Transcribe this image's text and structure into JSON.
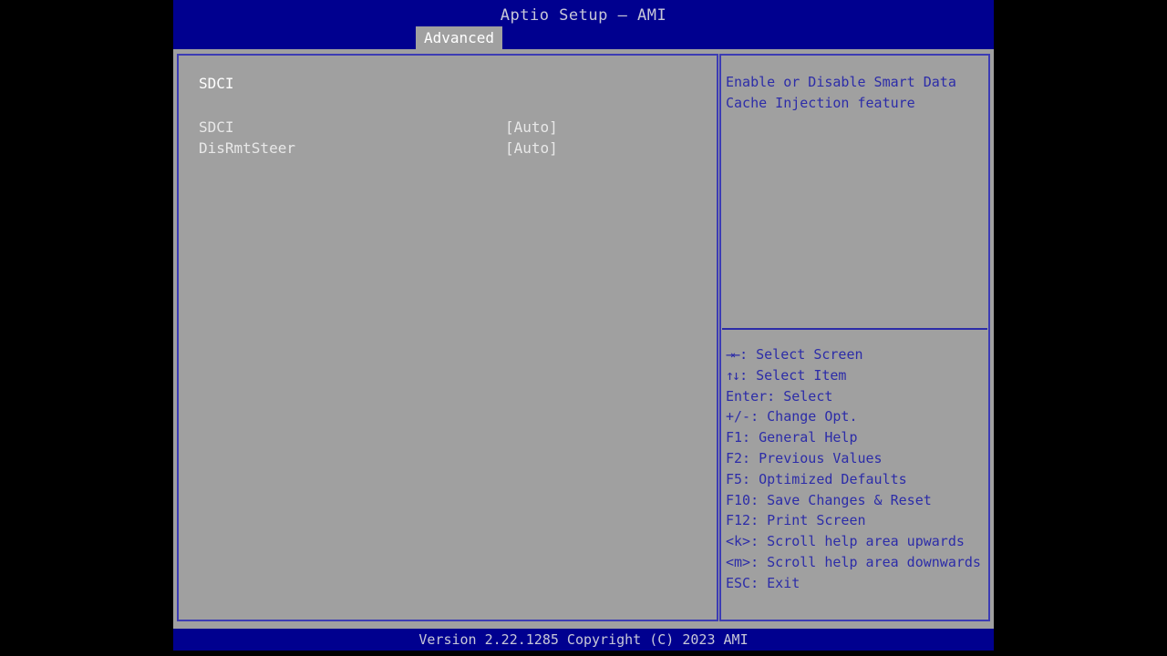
{
  "window": {
    "title": "Aptio Setup – AMI"
  },
  "tabs": [
    {
      "label": "Advanced",
      "active": true
    }
  ],
  "left_panel": {
    "section_title": "SDCI",
    "options": [
      {
        "label": "SDCI",
        "value": "[Auto]"
      },
      {
        "label": "DisRmtSteer",
        "value": "[Auto]"
      }
    ]
  },
  "right_panel": {
    "help_text": "Enable or Disable Smart Data Cache Injection feature",
    "key_legend": [
      {
        "glyph": "→←",
        "text": ": Select Screen"
      },
      {
        "glyph": "↑↓",
        "text": ": Select Item"
      },
      {
        "glyph": "",
        "text": "Enter: Select"
      },
      {
        "glyph": "",
        "text": "+/-: Change Opt."
      },
      {
        "glyph": "",
        "text": "F1: General Help"
      },
      {
        "glyph": "",
        "text": "F2: Previous Values"
      },
      {
        "glyph": "",
        "text": "F5: Optimized Defaults"
      },
      {
        "glyph": "",
        "text": "F10: Save Changes & Reset"
      },
      {
        "glyph": "",
        "text": "F12: Print Screen"
      },
      {
        "glyph": "",
        "text": "<k>: Scroll help area upwards"
      },
      {
        "glyph": "",
        "text": "<m>: Scroll help area downwards"
      },
      {
        "glyph": "",
        "text": "ESC: Exit"
      }
    ]
  },
  "footer": {
    "version_text": "Version 2.22.1285 Copyright (C) 2023 AMI"
  },
  "colors": {
    "header_blue": "#00008f",
    "panel_gray": "#a0a0a0",
    "border_blue": "#3c3cb4",
    "help_blue": "#2c2ca8",
    "text_white": "#ffffff",
    "footer_text": "#c8c8d8"
  }
}
